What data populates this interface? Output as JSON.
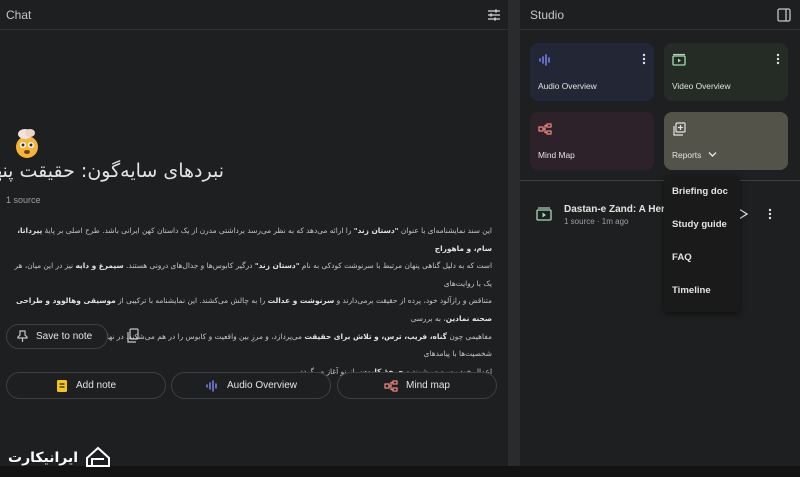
{
  "chat": {
    "title": "Chat",
    "notebook_title": "نبردهای سایه‌گون: حقیقت پنهان",
    "source_count": "1 source",
    "summary": {
      "l1_a": "این سند نمایشنامه‌ای با عنوان ",
      "l1_b": "\"دستان زند\"",
      "l1_c": " را ارائه می‌دهد که به نظر می‌رسد برداشتی مدرن از یک داستان کهن ایرانی باشد. طرح اصلی بر پایهٔ ",
      "l1_d": "پیرداتا، سام، و ماهوراج",
      "l2_a": "است که به دلیل گناهی پنهان مرتبط با سرنوشت کودکی به نام ",
      "l2_b": "\"دستان زند\"",
      "l2_c": " درگیر کابوس‌ها و جدال‌های درونی هستند. ",
      "l2_d": "سیمرغ و دایه",
      "l2_e": " نیز در این میان، هر یک با روایت‌های",
      "l3_a": "متناقض و رازآلود خود، پرده از حقیقت برمی‌دارند و ",
      "l3_b": "سرنوشت و عدالت",
      "l3_c": " را به چالش می‌کشند. این نمایشنامه با ترکیبی از ",
      "l3_d": "موسیقی و‌هالوود و طراحی صحنه نمادین",
      "l3_e": "، به بررسی",
      "l4_a": "مفاهیمی چون ",
      "l4_b": "گناه، فریب، ترس، و تلاش برای حقیقت",
      "l4_c": " می‌پردازد، و مرزِ بین واقعیت و کابوس را در هم می‌شکند. در نهایت، با افشای کامل حقیقت، شخصیت‌ها با پیامدهای",
      "l5_a": "اعمال خود روبرو می‌شوند و ",
      "l5_b": "چرخهٔ کابوس",
      "l5_c": " از نو آغاز می‌گردد."
    },
    "save_to_note": "Save to note",
    "actions": {
      "add_note": "Add note",
      "audio_overview": "Audio Overview",
      "mind_map": "Mind map"
    },
    "logo_text": "ایرانیکارت"
  },
  "studio": {
    "title": "Studio",
    "tiles": {
      "audio": "Audio Overview",
      "video": "Video Overview",
      "mind": "Mind Map",
      "reports": "Reports"
    },
    "note": {
      "title": "Dastan-e Zand: A Hero",
      "meta": "1 source · 1m ago"
    },
    "dropdown": [
      "Briefing doc",
      "Study guide",
      "FAQ",
      "Timeline"
    ]
  },
  "colors": {
    "background": "#131314",
    "panel": "#1e1f20",
    "audio_tile": "#232635",
    "video_tile": "#252b25",
    "mind_tile": "#2d2229",
    "reports_tile": "#545349",
    "add_note_icon": "#f5c518",
    "audio_icon": "#7b8cff",
    "mind_icon": "#f28b82",
    "video_icon": "#a8dab5"
  },
  "icons": [
    "tune-icon",
    "panel-icon",
    "more-vert-icon",
    "audio-wave-icon",
    "video-icon",
    "mind-map-icon",
    "reports-icon",
    "chevron-down-icon",
    "play-icon",
    "pin-icon",
    "copy-icon",
    "note-doc-icon",
    "add-note-icon"
  ]
}
